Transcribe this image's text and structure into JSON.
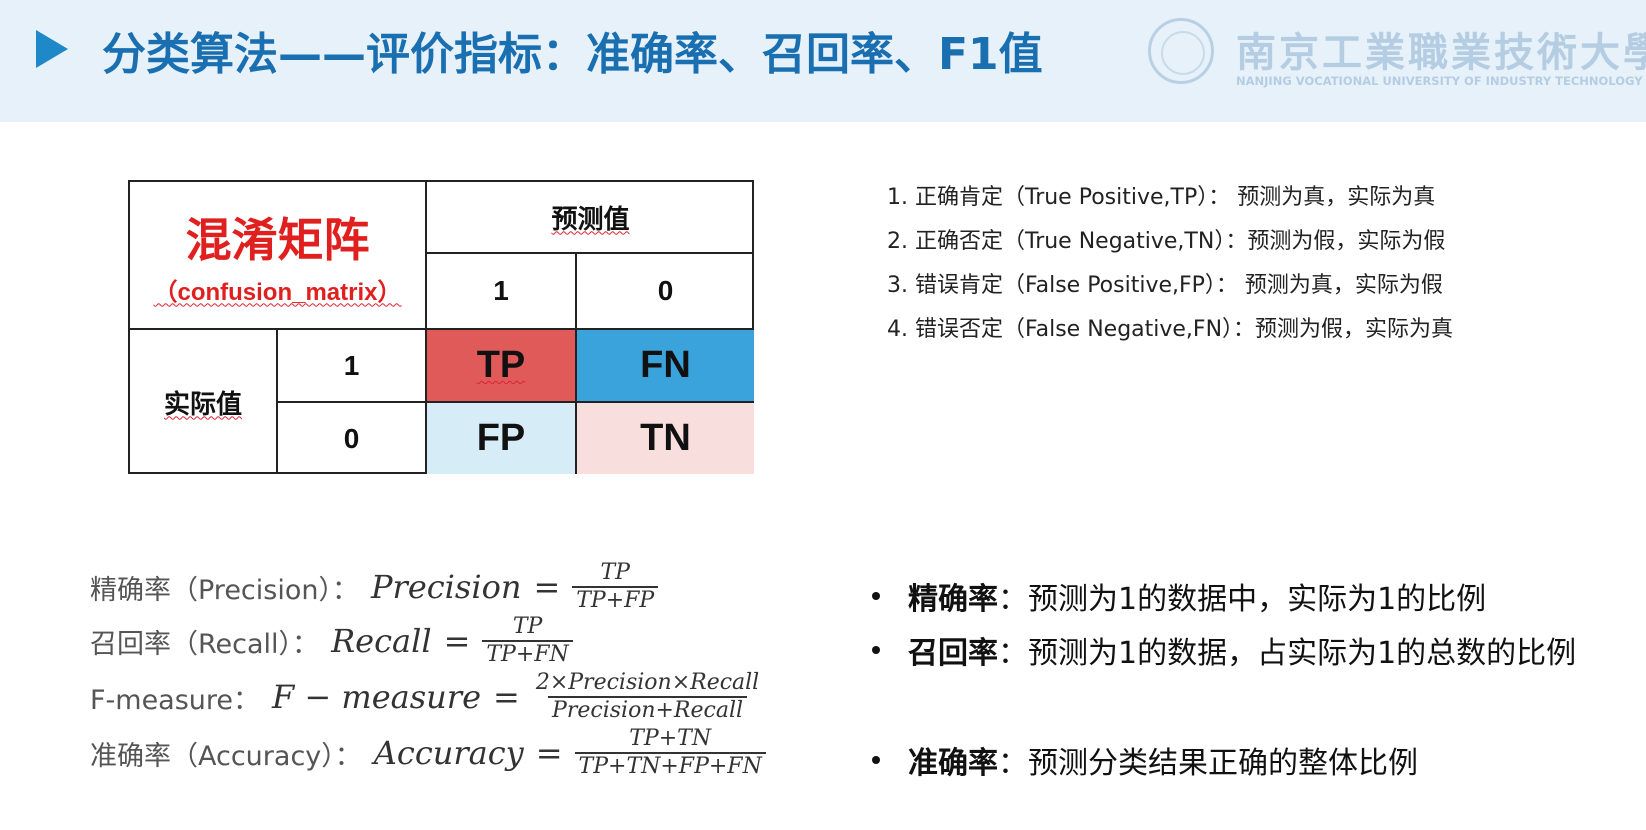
{
  "header": {
    "title": "分类算法——评价指标：准确率、召回率、F1值",
    "logo_cn": "南京工業職業技術大學",
    "logo_en": "NANJING VOCATIONAL UNIVERSITY OF INDUSTRY TECHNOLOGY",
    "icon": "play-triangle-icon",
    "accent_color": "#1a6fb0"
  },
  "matrix": {
    "title": "混淆矩阵",
    "subtitle": "（confusion_matrix）",
    "predicted_label": "预测值",
    "actual_label": "实际值",
    "pred_1": "1",
    "pred_0": "0",
    "act_1": "1",
    "act_0": "0",
    "tp": "TP",
    "fn": "FN",
    "fp": "FP",
    "tn": "TN",
    "colors": {
      "tp": "#e05a5a",
      "fn": "#3aa3dc",
      "fp": "#d6ecf7",
      "tn": "#f8dedd"
    }
  },
  "definitions": [
    "1. 正确肯定（True Positive,TP）：  预测为真，实际为真",
    "2. 正确否定（True Negative,TN）：预测为假，实际为假",
    "3. 错误肯定（False Positive,FP）：  预测为真，实际为假",
    "4. 错误否定（False Negative,FN）：预测为假，实际为真"
  ],
  "formulas": [
    {
      "label": "精确率（Precision）：",
      "lhs": "Precision",
      "eq": "=",
      "num": "TP",
      "den": "TP+FP"
    },
    {
      "label": "召回率（Recall）：",
      "lhs": "Recall",
      "eq": "=",
      "num": "TP",
      "den": "TP+FN"
    },
    {
      "label": "F-measure：",
      "lhs": "F − measure",
      "eq": "=",
      "num": "2×Precision×Recall",
      "den": "Precision+Recall"
    },
    {
      "label": "准确率（Accuracy）：",
      "lhs": "Accuracy",
      "eq": "=",
      "num": "TP+TN",
      "den": "TP+TN+FP+FN"
    }
  ],
  "bullets": [
    {
      "term": "精确率",
      "text": "：预测为1的数据中，实际为1的比例"
    },
    {
      "term": "召回率",
      "text": "：预测为1的数据，占实际为1的总数的比例"
    },
    {
      "term": "准确率",
      "text": "：预测分类结果正确的整体比例"
    }
  ]
}
